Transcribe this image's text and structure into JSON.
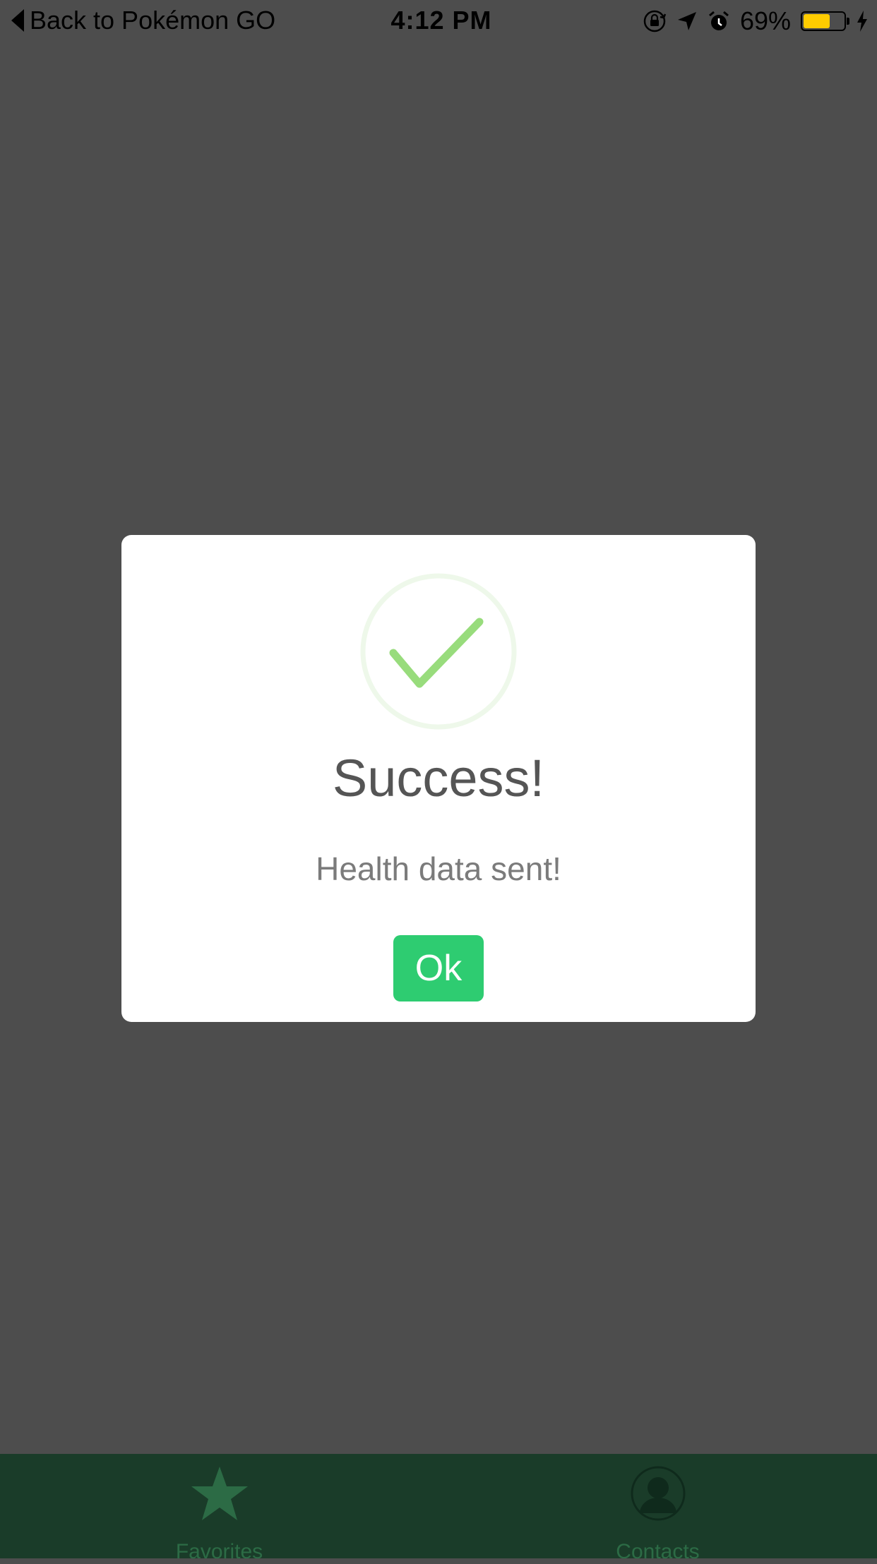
{
  "status_bar": {
    "back_label": "Back to Pokémon GO",
    "time": "4:12 PM",
    "battery_percent": "69%",
    "battery_level": 0.69,
    "icons": [
      "orientation-lock-icon",
      "location-arrow-icon",
      "alarm-icon",
      "battery-icon",
      "charging-bolt-icon"
    ]
  },
  "modal": {
    "icon": "checkmark-circle-icon",
    "title": "Success!",
    "message": "Health data sent!",
    "ok_label": "Ok"
  },
  "tab_bar": {
    "tabs": [
      {
        "label": "Favorites",
        "icon": "star-icon"
      },
      {
        "label": "Contacts",
        "icon": "contact-silhouette-icon"
      }
    ]
  },
  "colors": {
    "overlay": "#4d4d4d",
    "modal_background": "#ffffff",
    "success_green": "#2ecc71",
    "checkmark_green": "#98dc7c",
    "tab_bar_background": "#1a3c29",
    "battery_yellow": "#ffcc00"
  }
}
